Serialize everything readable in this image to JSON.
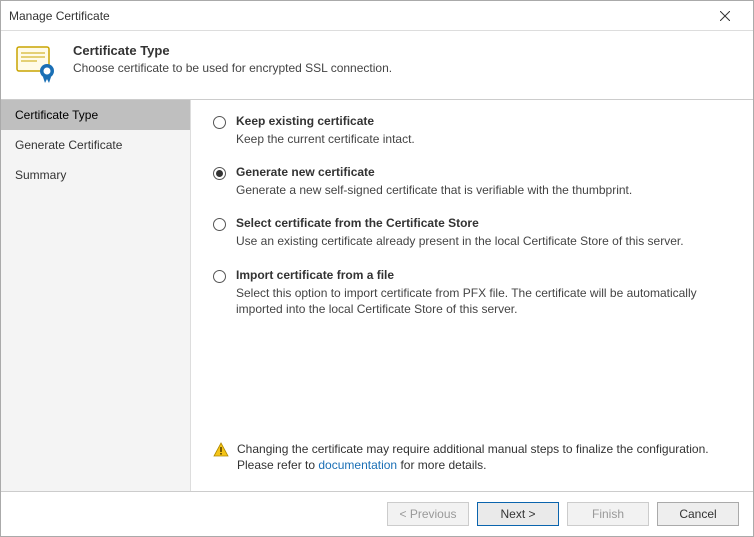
{
  "window": {
    "title": "Manage Certificate"
  },
  "header": {
    "title": "Certificate Type",
    "description": "Choose certificate to be used for encrypted SSL connection."
  },
  "sidebar": {
    "items": [
      {
        "label": "Certificate Type",
        "active": true
      },
      {
        "label": "Generate Certificate",
        "active": false
      },
      {
        "label": "Summary",
        "active": false
      }
    ]
  },
  "options": [
    {
      "id": "keep",
      "title": "Keep existing certificate",
      "description": "Keep the current certificate intact.",
      "selected": false
    },
    {
      "id": "generate",
      "title": "Generate new certificate",
      "description": "Generate a new self-signed certificate that is verifiable with the thumbprint.",
      "selected": true
    },
    {
      "id": "select-store",
      "title": "Select certificate from the Certificate Store",
      "description": "Use an existing certificate already present in the local Certificate Store of this server.",
      "selected": false
    },
    {
      "id": "import-file",
      "title": "Import certificate from a file",
      "description": "Select this option to import certificate from PFX file. The certificate will be automatically imported into the local Certificate Store of this server.",
      "selected": false
    }
  ],
  "warning": {
    "text_before": "Changing the certificate may require additional manual steps to finalize the configuration. Please refer to ",
    "link_text": "documentation",
    "text_after": " for more details."
  },
  "footer": {
    "previous": "< Previous",
    "next": "Next >",
    "finish": "Finish",
    "cancel": "Cancel"
  }
}
